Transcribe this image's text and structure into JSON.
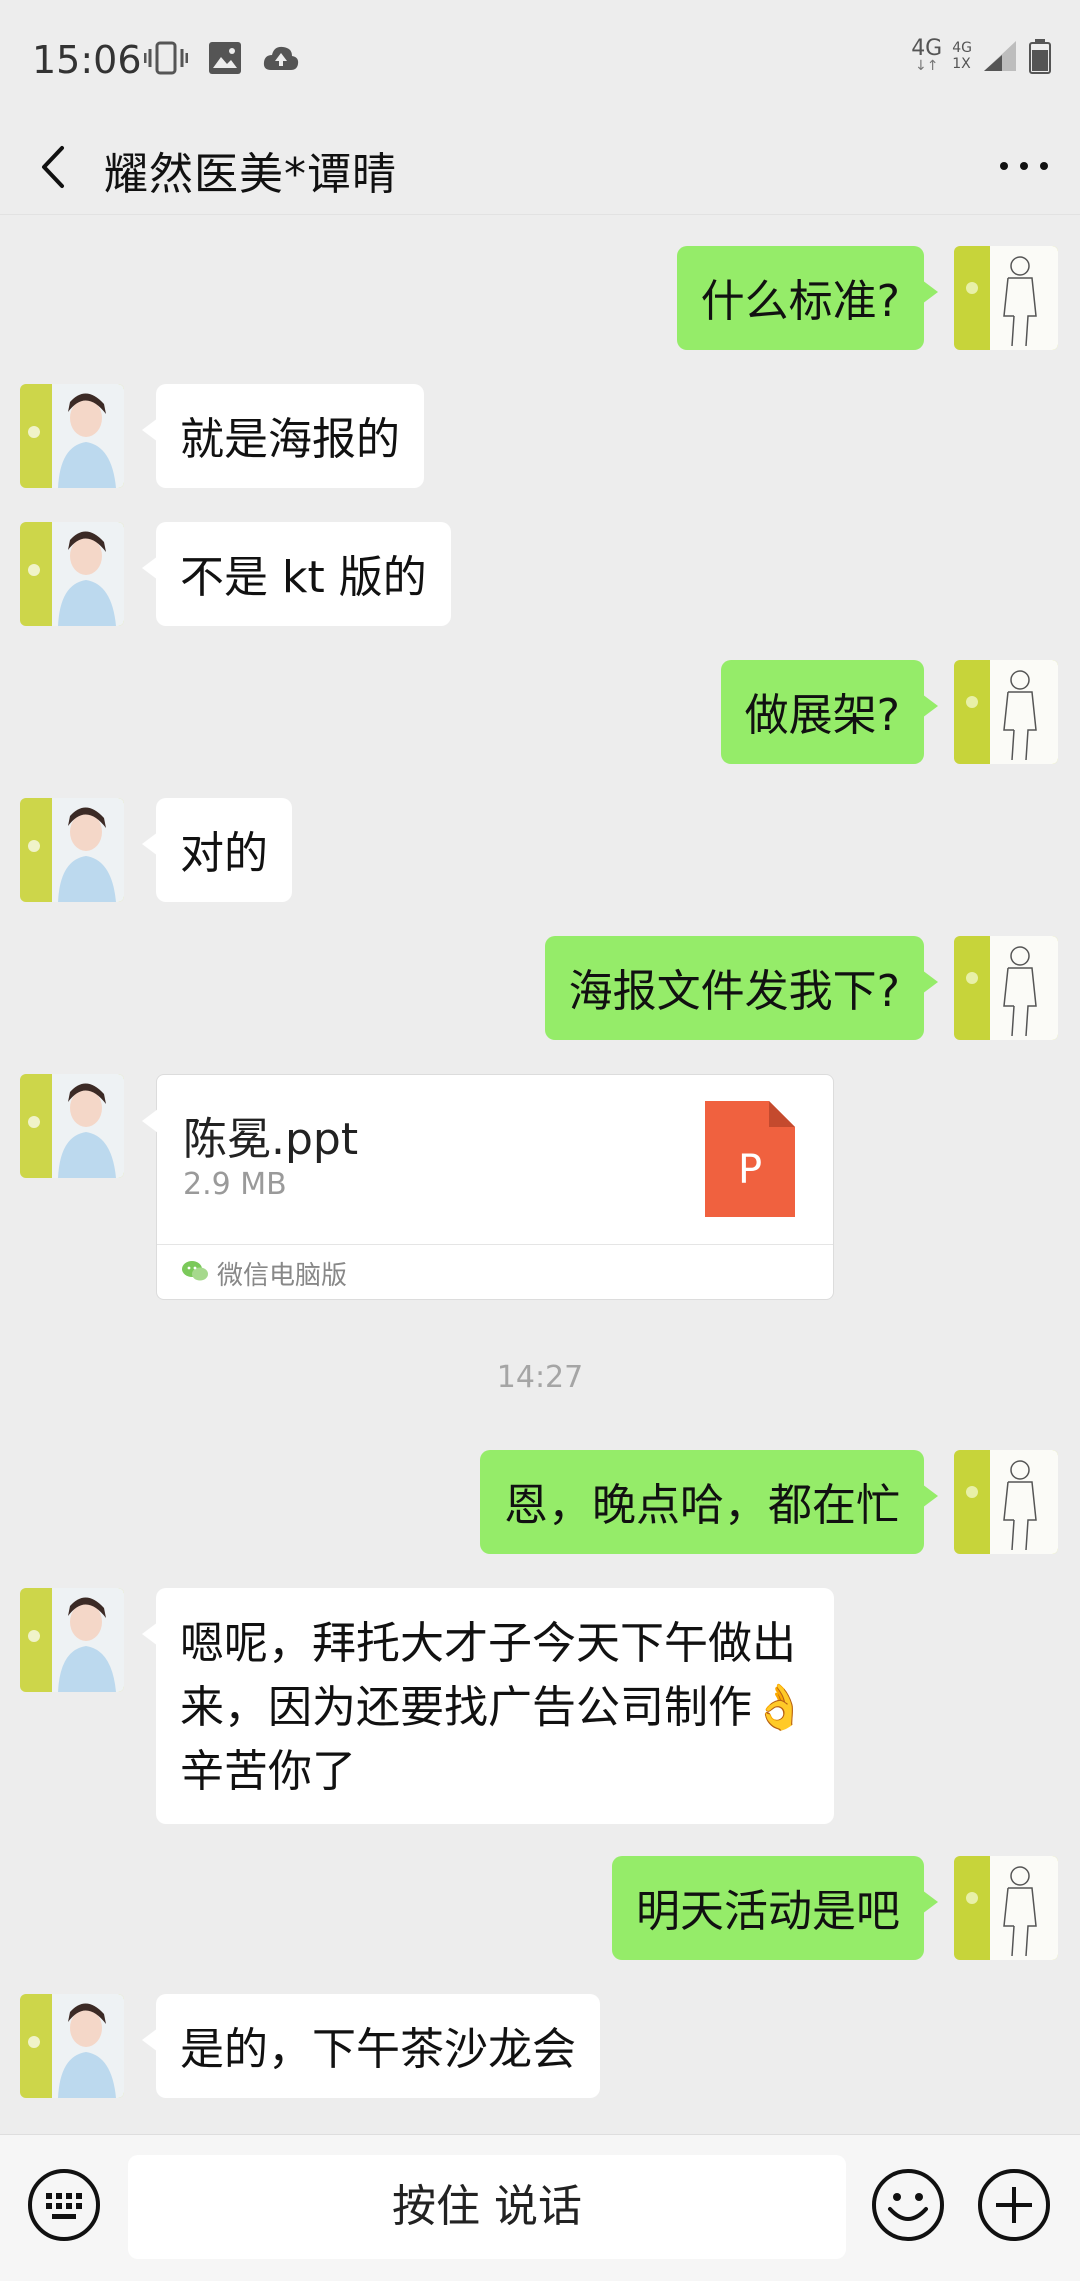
{
  "status_bar": {
    "time": "15:06",
    "network_top": "4G",
    "network_top2": "4G",
    "network_bottom": "1X"
  },
  "header": {
    "title": "耀然医美*谭晴"
  },
  "messages": [
    {
      "from": "me",
      "text": "什么标准?"
    },
    {
      "from": "other",
      "text": "就是海报的"
    },
    {
      "from": "other",
      "text": "不是 kt 版的"
    },
    {
      "from": "me",
      "text": "做展架?"
    },
    {
      "from": "other",
      "text": "对的"
    },
    {
      "from": "me",
      "text": "海报文件发我下?"
    },
    {
      "from": "other",
      "type": "file",
      "file_name": "陈冕.ppt",
      "file_size": "2.9 MB",
      "file_badge": "P",
      "source": "微信电脑版"
    },
    {
      "type": "time",
      "text": "14:27"
    },
    {
      "from": "me",
      "text": "恩，晚点哈，都在忙"
    },
    {
      "from": "other",
      "text": "嗯呢，拜托大才子今天下午做出来，因为还要找广告公司制作👌辛苦你了"
    },
    {
      "from": "me",
      "text": "明天活动是吧"
    },
    {
      "from": "other",
      "text": "是的，下午茶沙龙会"
    }
  ],
  "input_bar": {
    "hold_to_talk_label": "按住 说话"
  },
  "colors": {
    "my_bubble": "#95ec69",
    "other_bubble": "#ffffff",
    "background": "#ededed",
    "ppt_icon": "#f0613f"
  }
}
